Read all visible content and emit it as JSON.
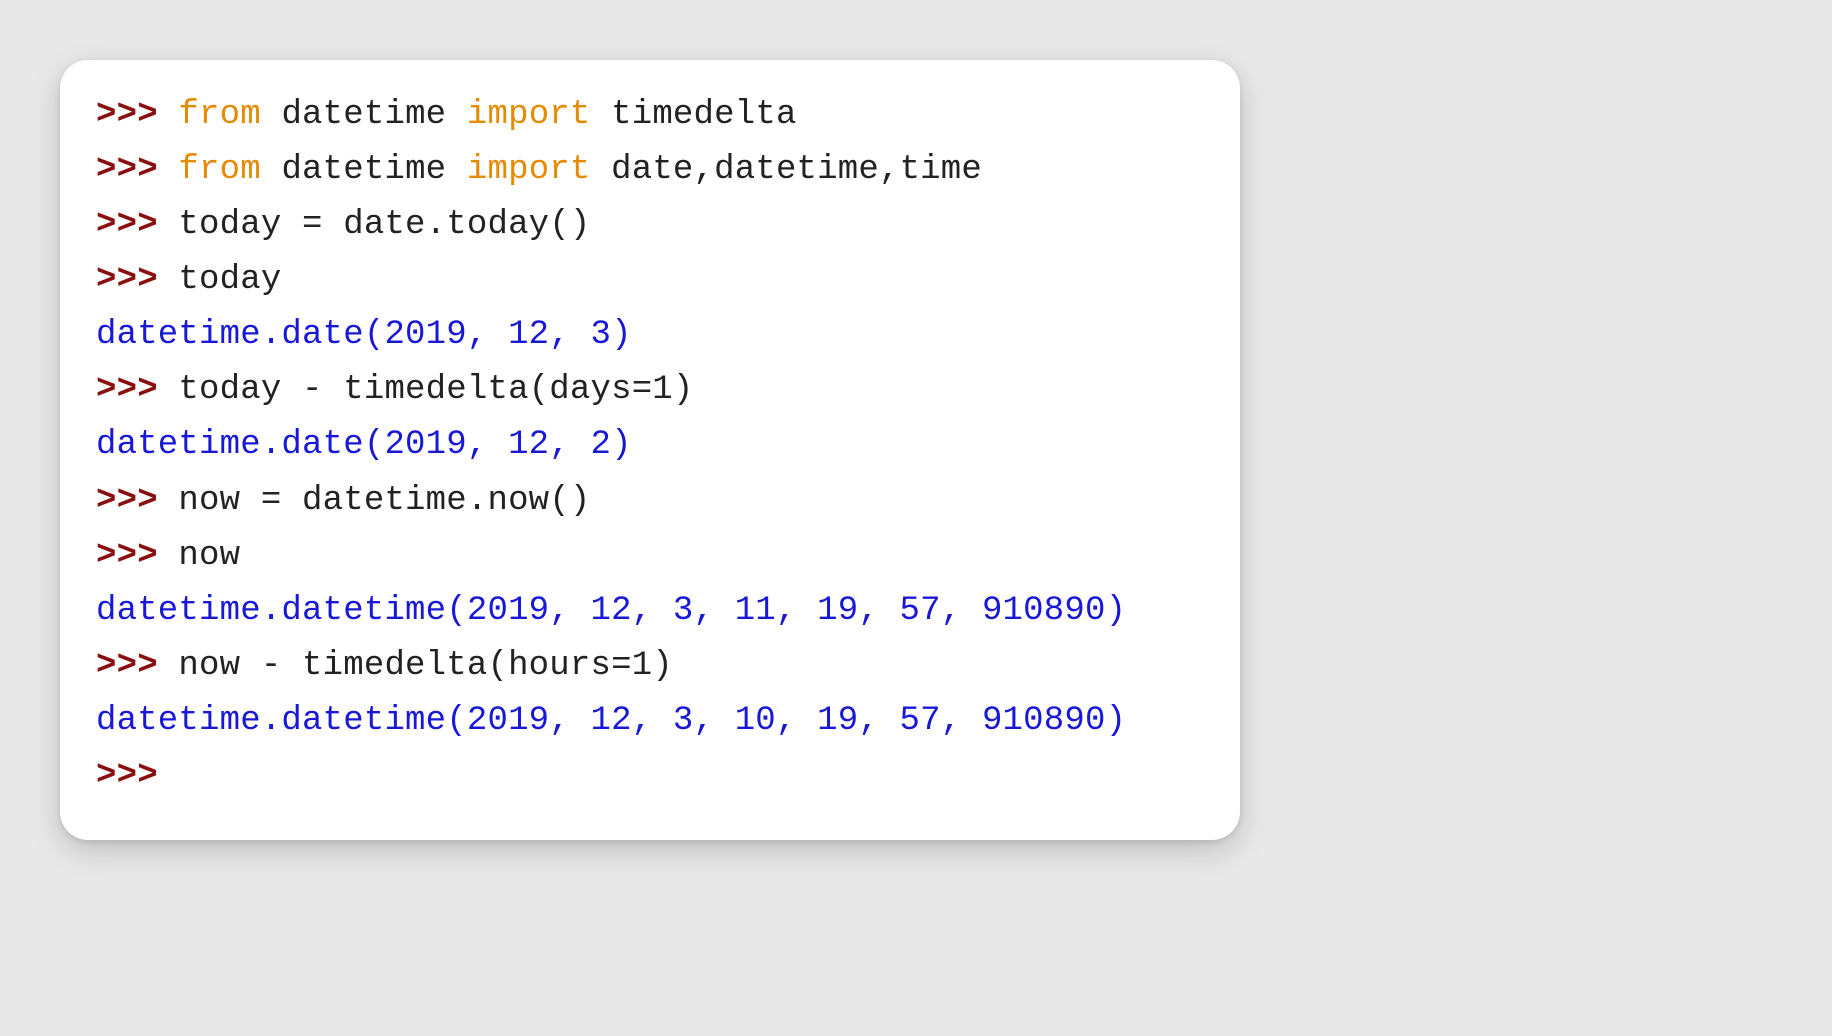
{
  "terminal": {
    "prompt": ">>> ",
    "empty_prompt": ">>>",
    "lines": [
      {
        "kw1": "from",
        "txt1": " datetime ",
        "kw2": "import",
        "txt2": " timedelta"
      },
      {
        "kw1": "from",
        "txt1": " datetime ",
        "kw2": "import",
        "txt2": " date,datetime,time"
      },
      {
        "code": "today = date.today()"
      },
      {
        "code": "today"
      },
      {
        "output": "datetime.date(2019, 12, 3)"
      },
      {
        "code": "today - timedelta(days=1)"
      },
      {
        "output": "datetime.date(2019, 12, 2)"
      },
      {
        "code": "now = datetime.now()"
      },
      {
        "code": "now"
      },
      {
        "output": "datetime.datetime(2019, 12, 3, 11, 19, 57, 910890)"
      },
      {
        "code": "now - timedelta(hours=1)"
      },
      {
        "output": "datetime.datetime(2019, 12, 3, 10, 19, 57, 910890)"
      }
    ]
  }
}
